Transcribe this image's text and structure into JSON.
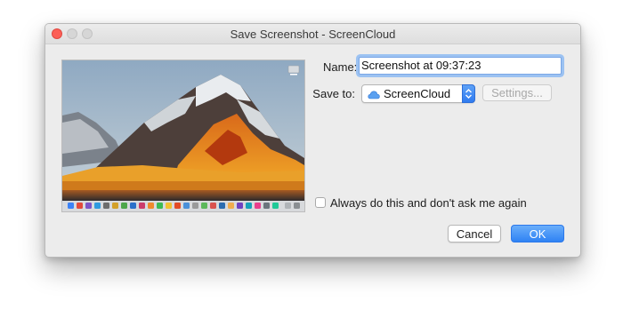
{
  "window": {
    "title": "Save Screenshot - ScreenCloud"
  },
  "form": {
    "name_label": "Name:",
    "name_value": "Screenshot at 09:37:23",
    "save_to_label": "Save to:",
    "save_to_value": "ScreenCloud",
    "settings_label": "Settings...",
    "always_label": "Always do this and don't ask me again",
    "always_checked": false
  },
  "buttons": {
    "cancel_label": "Cancel",
    "ok_label": "OK"
  },
  "colors": {
    "accent": "#3a87f5",
    "close": "#fc5f57",
    "window_bg": "#ececec"
  },
  "icons": {
    "preview": "screenshot-thumbnail",
    "save_service": "cloud-icon",
    "select_arrows": "chevron-updown-icon"
  }
}
